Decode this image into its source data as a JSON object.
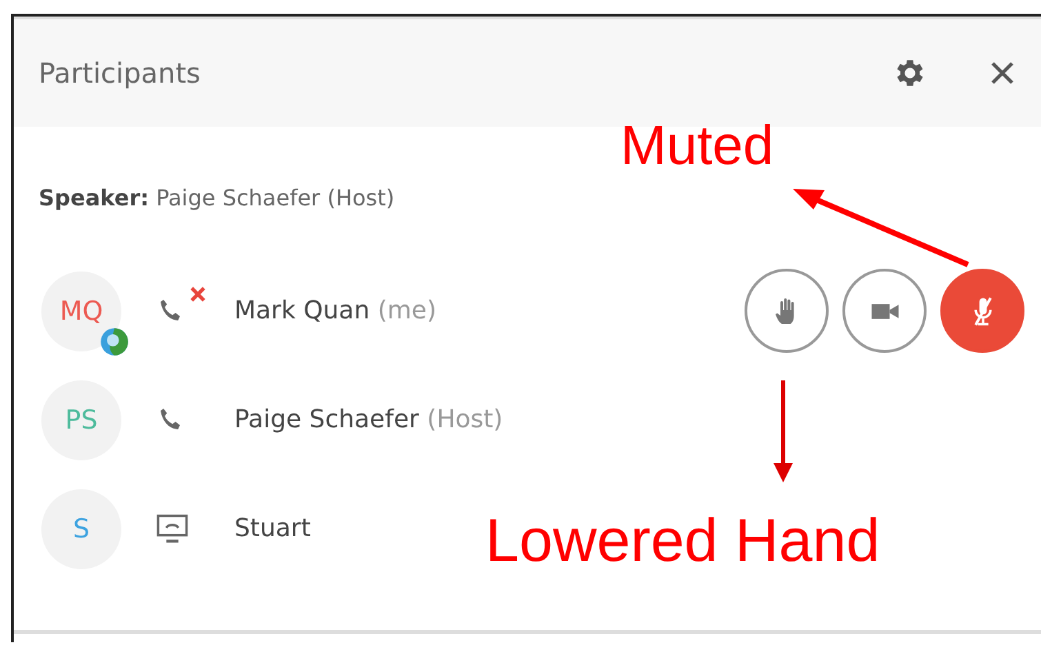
{
  "panel": {
    "title": "Participants"
  },
  "speaker": {
    "label": "Speaker:",
    "name": "Paige Schaefer (Host)"
  },
  "participants": [
    {
      "initials": "MQ",
      "color": "#ec5a52",
      "status_badge": true,
      "kind": "phone",
      "audio_muted": true,
      "name": "Mark Quan",
      "role": "(me)",
      "controls": [
        {
          "kind": "hand",
          "on": false
        },
        {
          "kind": "video",
          "on": false
        },
        {
          "kind": "mic",
          "on": true
        }
      ]
    },
    {
      "initials": "PS",
      "color": "#4dbb9c",
      "status_badge": false,
      "kind": "phone",
      "audio_muted": false,
      "name": "Paige Schaefer",
      "role": "(Host)"
    },
    {
      "initials": "S",
      "color": "#3ea3e0",
      "status_badge": false,
      "kind": "screen",
      "audio_muted": false,
      "name": "Stuart"
    }
  ],
  "annotations": [
    {
      "kind": "up",
      "text": "Muted"
    },
    {
      "kind": "down",
      "text": "Lowered Hand"
    }
  ]
}
